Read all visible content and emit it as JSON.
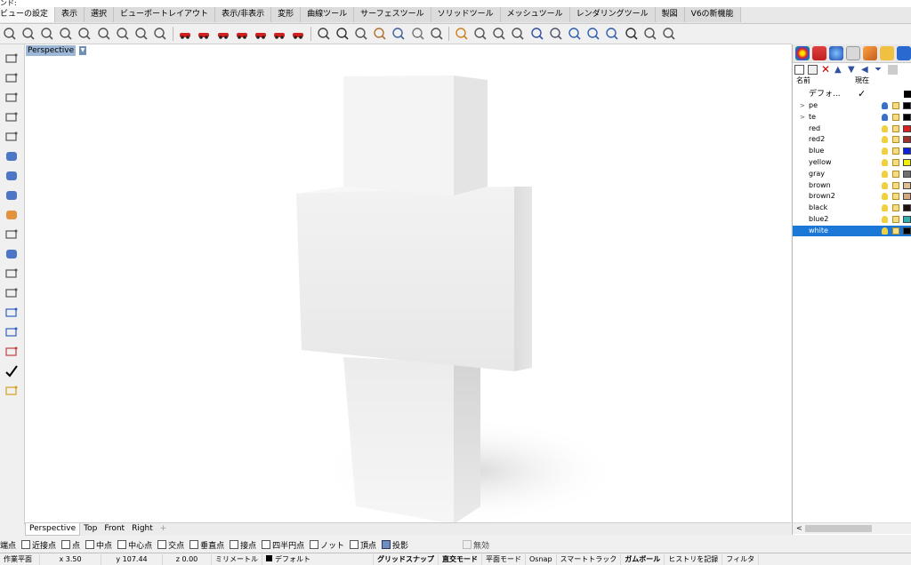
{
  "command_prompt": "ンド:",
  "menu_tabs": [
    "ビューの設定",
    "表示",
    "選択",
    "ビューポートレイアウト",
    "表示/非表示",
    "変形",
    "曲線ツール",
    "サーフェスツール",
    "ソリッドツール",
    "メッシュツール",
    "レンダリングツール",
    "製図",
    "V6の新機能"
  ],
  "toolbar_icons": [
    "rotate-view-icon",
    "pan-view-icon",
    "zoom-window-icon",
    "zoom-extents-icon",
    "zoom-selected-icon",
    "zoom-all-icon",
    "undo-view-icon",
    "zoom-target-icon",
    "named-views-icon",
    "car-red-icon",
    "car-tall-icon",
    "car-small-icon",
    "car-sedan-icon",
    "car-sport-icon",
    "car-flat-icon",
    "car-coupe-icon",
    "render-icon",
    "camera-icon",
    "capture-viewport-icon",
    "layout-icon",
    "materials-icon",
    "environment-icon",
    "osnap-icon",
    "gumball-icon",
    "select-icon",
    "crossing-icon",
    "move-icon",
    "dimension-icon",
    "plane-icon",
    "jet-icon",
    "boat-icon",
    "rotate-icon",
    "walk-icon",
    "light-icon",
    "target-icon"
  ],
  "left_toolbar_icons": [
    "point-icon",
    "polyline-icon",
    "circle-icon",
    "rectangle-icon",
    "curve-icon",
    "surface-icon",
    "solid-icon",
    "mesh-icon",
    "explode-icon",
    "extrude-icon",
    "points-icon",
    "arc-icon",
    "transform-icon",
    "mirror-icon",
    "dimension-icon",
    "gumball-icon",
    "check-icon",
    "layer-icon"
  ],
  "viewport": {
    "title": "Perspective",
    "menu_arrow": "▼"
  },
  "viewport_tabs": [
    "Perspective",
    "Top",
    "Front",
    "Right"
  ],
  "viewport_tab_add": "+",
  "osnap": [
    {
      "label": "端点",
      "on": false,
      "visible_checkbox": false
    },
    {
      "label": "近接点",
      "on": false
    },
    {
      "label": "点",
      "on": false
    },
    {
      "label": "中点",
      "on": false
    },
    {
      "label": "中心点",
      "on": false
    },
    {
      "label": "交点",
      "on": false
    },
    {
      "label": "垂直点",
      "on": false
    },
    {
      "label": "接点",
      "on": false
    },
    {
      "label": "四半円点",
      "on": false
    },
    {
      "label": "ノット",
      "on": false
    },
    {
      "label": "頂点",
      "on": false
    },
    {
      "label": "投影",
      "on": true
    },
    {
      "label": "無効",
      "on": false,
      "disabled": true
    }
  ],
  "status": {
    "cplane": "作業平面",
    "x": "x 3.50",
    "y": "y 107.44",
    "z": "z 0.00",
    "unit": "ミリメートル",
    "layer": "デフォルト",
    "grid_snap": "グリッドスナップ",
    "ortho": "直交モード",
    "planar": "平面モード",
    "osnap": "Osnap",
    "smart_track": "スマートトラック",
    "gumball": "ガムボール",
    "history": "ヒストリを記録",
    "filter": "フィルタ"
  },
  "layers_panel": {
    "col_name": "名前",
    "col_current": "現在",
    "default_layer": "デフォ...",
    "current_mark": "✓",
    "layers": [
      {
        "name": "pe",
        "expandable": true,
        "color": "#000000"
      },
      {
        "name": "te",
        "expandable": true,
        "color": "#000000"
      },
      {
        "name": "red",
        "color": "#e02020"
      },
      {
        "name": "red2",
        "color": "#a0302a"
      },
      {
        "name": "blue",
        "color": "#1020e0"
      },
      {
        "name": "yellow",
        "color": "#f0f000"
      },
      {
        "name": "gray",
        "color": "#707070"
      },
      {
        "name": "brown",
        "color": "#e0c090"
      },
      {
        "name": "brown2",
        "color": "#d4a880"
      },
      {
        "name": "black",
        "color": "#201010"
      },
      {
        "name": "blue2",
        "color": "#30b0b0"
      },
      {
        "name": "white",
        "color": "#000000",
        "selected": true
      }
    ],
    "scroll_left": "<"
  },
  "colors": {
    "selection": "#1b78d6",
    "viewport_title_bg": "#9db7d6"
  }
}
